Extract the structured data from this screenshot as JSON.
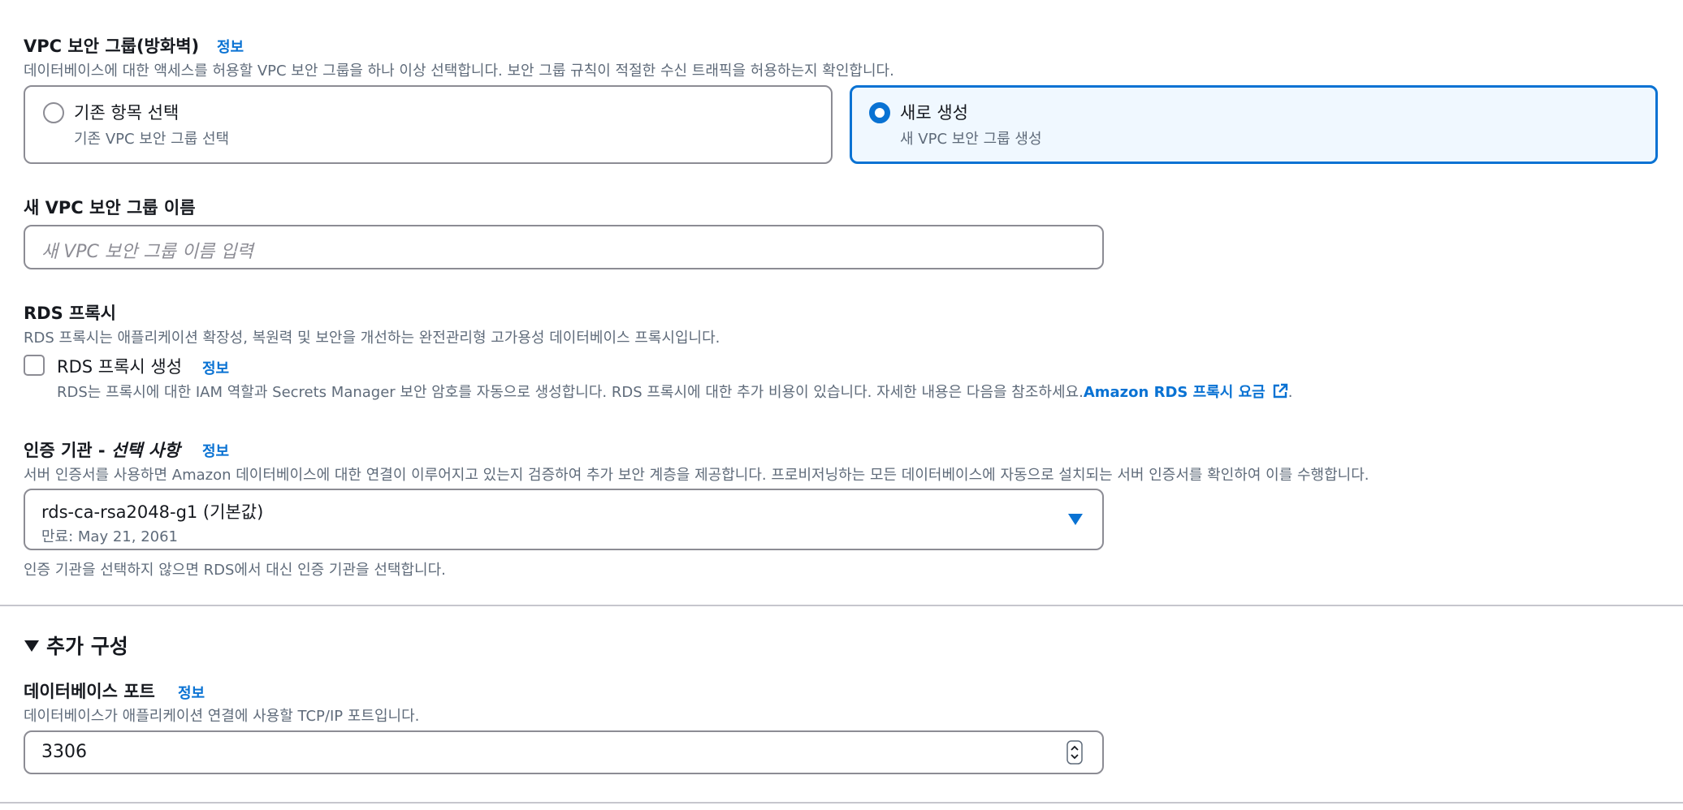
{
  "vpc_sg": {
    "label": "VPC 보안 그룹(방화벽)",
    "info": "정보",
    "description": "데이터베이스에 대한 액세스를 허용할 VPC 보안 그룹을 하나 이상 선택합니다. 보안 그룹 규칙이 적절한 수신 트래픽을 허용하는지 확인합니다.",
    "options": [
      {
        "title": "기존 항목 선택",
        "subtitle": "기존 VPC 보안 그룹 선택",
        "selected": false
      },
      {
        "title": "새로 생성",
        "subtitle": "새 VPC 보안 그룹 생성",
        "selected": true
      }
    ]
  },
  "new_sg_name": {
    "label": "새 VPC 보안 그룹 이름",
    "placeholder": "새 VPC 보안 그룹 이름 입력",
    "value": ""
  },
  "rds_proxy": {
    "label": "RDS 프록시",
    "description": "RDS 프록시는 애플리케이션 확장성, 복원력 및 보안을 개선하는 완전관리형 고가용성 데이터베이스 프록시입니다.",
    "checkbox_label": "RDS 프록시 생성",
    "checked": false,
    "info": "정보",
    "checkbox_description": "RDS는 프록시에 대한 IAM 역할과 Secrets Manager 보안 암호를 자동으로 생성합니다. RDS 프록시에 대한 추가 비용이 있습니다. 자세한 내용은 다음을 참조하세요.",
    "link_text": "Amazon RDS 프록시 요금",
    "trailing": "."
  },
  "ca": {
    "label": "인증 기관 - ",
    "label_optional": "선택 사항",
    "info": "정보",
    "description": "서버 인증서를 사용하면 Amazon 데이터베이스에 대한 연결이 이루어지고 있는지 검증하여 추가 보안 계층을 제공합니다. 프로비저닝하는 모든 데이터베이스에 자동으로 설치되는 서버 인증서를 확인하여 이를 수행합니다.",
    "selected_value": "rds-ca-rsa2048-g1 (기본값)",
    "selected_sub": "만료: May 21, 2061",
    "hint": "인증 기관을 선택하지 않으면 RDS에서 대신 인증 기관을 선택합니다."
  },
  "additional_config": {
    "title": "추가 구성",
    "expanded": true
  },
  "db_port": {
    "label": "데이터베이스 포트",
    "info": "정보",
    "description": "데이터베이스가 애플리케이션 연결에 사용할 TCP/IP 포트입니다.",
    "value": "3306"
  },
  "colors": {
    "accent": "#0972d3",
    "text": "#16191f",
    "secondary_text": "#5f6b7a",
    "border": "#8c8c94",
    "selected_bg": "#f0f8ff"
  }
}
